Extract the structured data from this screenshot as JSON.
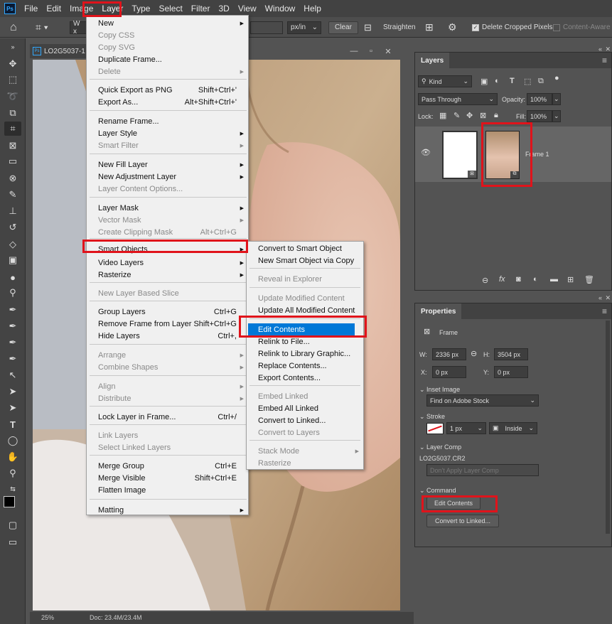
{
  "menubar": {
    "logo": "Ps",
    "items": [
      "File",
      "Edit",
      "Image",
      "Layer",
      "Type",
      "Select",
      "Filter",
      "3D",
      "View",
      "Window",
      "Help"
    ]
  },
  "options": {
    "width_field": "W x",
    "units": "px/in",
    "clear": "Clear",
    "straighten": "Straighten",
    "delete_cropped": "Delete Cropped Pixels",
    "content_aware": "Content-Aware"
  },
  "document": {
    "tab_title": "LO2G5037-1",
    "zoom": "25%",
    "doc_info": "Doc: 23.4M/23.4M"
  },
  "layer_menu": {
    "items": [
      {
        "label": "New",
        "shortcut": "",
        "arrow": true,
        "disabled": false
      },
      {
        "label": "Copy CSS",
        "shortcut": "",
        "arrow": false,
        "disabled": true
      },
      {
        "label": "Copy SVG",
        "shortcut": "",
        "arrow": false,
        "disabled": true
      },
      {
        "label": "Duplicate Frame...",
        "shortcut": "",
        "arrow": false,
        "disabled": false
      },
      {
        "label": "Delete",
        "shortcut": "",
        "arrow": true,
        "disabled": true
      },
      {
        "label": "Quick Export as PNG",
        "shortcut": "Shift+Ctrl+'",
        "arrow": false,
        "disabled": false
      },
      {
        "label": "Export As...",
        "shortcut": "Alt+Shift+Ctrl+'",
        "arrow": false,
        "disabled": false
      },
      {
        "label": "Rename Frame...",
        "shortcut": "",
        "arrow": false,
        "disabled": false
      },
      {
        "label": "Layer Style",
        "shortcut": "",
        "arrow": true,
        "disabled": false
      },
      {
        "label": "Smart Filter",
        "shortcut": "",
        "arrow": true,
        "disabled": true
      },
      {
        "label": "New Fill Layer",
        "shortcut": "",
        "arrow": true,
        "disabled": false
      },
      {
        "label": "New Adjustment Layer",
        "shortcut": "",
        "arrow": true,
        "disabled": false
      },
      {
        "label": "Layer Content Options...",
        "shortcut": "",
        "arrow": false,
        "disabled": true
      },
      {
        "label": "Layer Mask",
        "shortcut": "",
        "arrow": true,
        "disabled": false
      },
      {
        "label": "Vector Mask",
        "shortcut": "",
        "arrow": true,
        "disabled": true
      },
      {
        "label": "Create Clipping Mask",
        "shortcut": "Alt+Ctrl+G",
        "arrow": false,
        "disabled": true
      },
      {
        "label": "Smart Objects",
        "shortcut": "",
        "arrow": true,
        "disabled": false
      },
      {
        "label": "Video Layers",
        "shortcut": "",
        "arrow": true,
        "disabled": false
      },
      {
        "label": "Rasterize",
        "shortcut": "",
        "arrow": true,
        "disabled": false
      },
      {
        "label": "New Layer Based Slice",
        "shortcut": "",
        "arrow": false,
        "disabled": true
      },
      {
        "label": "Group Layers",
        "shortcut": "Ctrl+G",
        "arrow": false,
        "disabled": false
      },
      {
        "label": "Remove Frame from Layer",
        "shortcut": "Shift+Ctrl+G",
        "arrow": false,
        "disabled": false
      },
      {
        "label": "Hide Layers",
        "shortcut": "Ctrl+,",
        "arrow": false,
        "disabled": false
      },
      {
        "label": "Arrange",
        "shortcut": "",
        "arrow": true,
        "disabled": true
      },
      {
        "label": "Combine Shapes",
        "shortcut": "",
        "arrow": true,
        "disabled": true
      },
      {
        "label": "Align",
        "shortcut": "",
        "arrow": true,
        "disabled": true
      },
      {
        "label": "Distribute",
        "shortcut": "",
        "arrow": true,
        "disabled": true
      },
      {
        "label": "Lock Layer in Frame...",
        "shortcut": "Ctrl+/",
        "arrow": false,
        "disabled": false
      },
      {
        "label": "Link Layers",
        "shortcut": "",
        "arrow": false,
        "disabled": true
      },
      {
        "label": "Select Linked Layers",
        "shortcut": "",
        "arrow": false,
        "disabled": true
      },
      {
        "label": "Merge Group",
        "shortcut": "Ctrl+E",
        "arrow": false,
        "disabled": false
      },
      {
        "label": "Merge Visible",
        "shortcut": "Shift+Ctrl+E",
        "arrow": false,
        "disabled": false
      },
      {
        "label": "Flatten Image",
        "shortcut": "",
        "arrow": false,
        "disabled": false
      },
      {
        "label": "Matting",
        "shortcut": "",
        "arrow": true,
        "disabled": false
      }
    ]
  },
  "smart_menu": {
    "items": [
      {
        "label": "Convert to Smart Object",
        "disabled": false,
        "arrow": false
      },
      {
        "label": "New Smart Object via Copy",
        "disabled": false,
        "arrow": false
      },
      {
        "label": "Reveal in Explorer",
        "disabled": true,
        "arrow": false
      },
      {
        "label": "Update Modified Content",
        "disabled": true,
        "arrow": false
      },
      {
        "label": "Update All Modified Content",
        "disabled": false,
        "arrow": false
      },
      {
        "label": "Edit Contents",
        "disabled": false,
        "arrow": false
      },
      {
        "label": "Relink to File...",
        "disabled": false,
        "arrow": false
      },
      {
        "label": "Relink to Library Graphic...",
        "disabled": false,
        "arrow": false
      },
      {
        "label": "Replace Contents...",
        "disabled": false,
        "arrow": false
      },
      {
        "label": "Export Contents...",
        "disabled": false,
        "arrow": false
      },
      {
        "label": "Embed Linked",
        "disabled": true,
        "arrow": false
      },
      {
        "label": "Embed All Linked",
        "disabled": false,
        "arrow": false
      },
      {
        "label": "Convert to Linked...",
        "disabled": false,
        "arrow": false
      },
      {
        "label": "Convert to Layers",
        "disabled": true,
        "arrow": false
      },
      {
        "label": "Stack Mode",
        "disabled": true,
        "arrow": true
      },
      {
        "label": "Rasterize",
        "disabled": true,
        "arrow": false
      }
    ]
  },
  "layers_panel": {
    "title": "Layers",
    "kind": "Kind",
    "blend": "Pass Through",
    "opacity_label": "Opacity:",
    "opacity": "100%",
    "lock_label": "Lock:",
    "fill_label": "Fill:",
    "fill": "100%",
    "layer_name": "Frame 1"
  },
  "properties_panel": {
    "title": "Properties",
    "type_label": "Frame",
    "w_label": "W:",
    "w": "2336 px",
    "h_label": "H:",
    "h": "3504 px",
    "x_label": "X:",
    "x": "0 px",
    "y_label": "Y:",
    "y": "0 px",
    "inset_section": "Inset Image",
    "inset_value": "Find on Adobe Stock",
    "stroke_section": "Stroke",
    "stroke_size": "1 px",
    "stroke_pos": "Inside",
    "comp_section": "Layer Comp",
    "comp_file": "LO2G5037.CR2",
    "comp_value": "Don't Apply Layer Comp",
    "command_section": "Command",
    "edit_btn": "Edit Contents",
    "linked_btn": "Convert to Linked..."
  },
  "colors": {
    "highlight": "#0078d7",
    "annotation": "#e0131b"
  }
}
